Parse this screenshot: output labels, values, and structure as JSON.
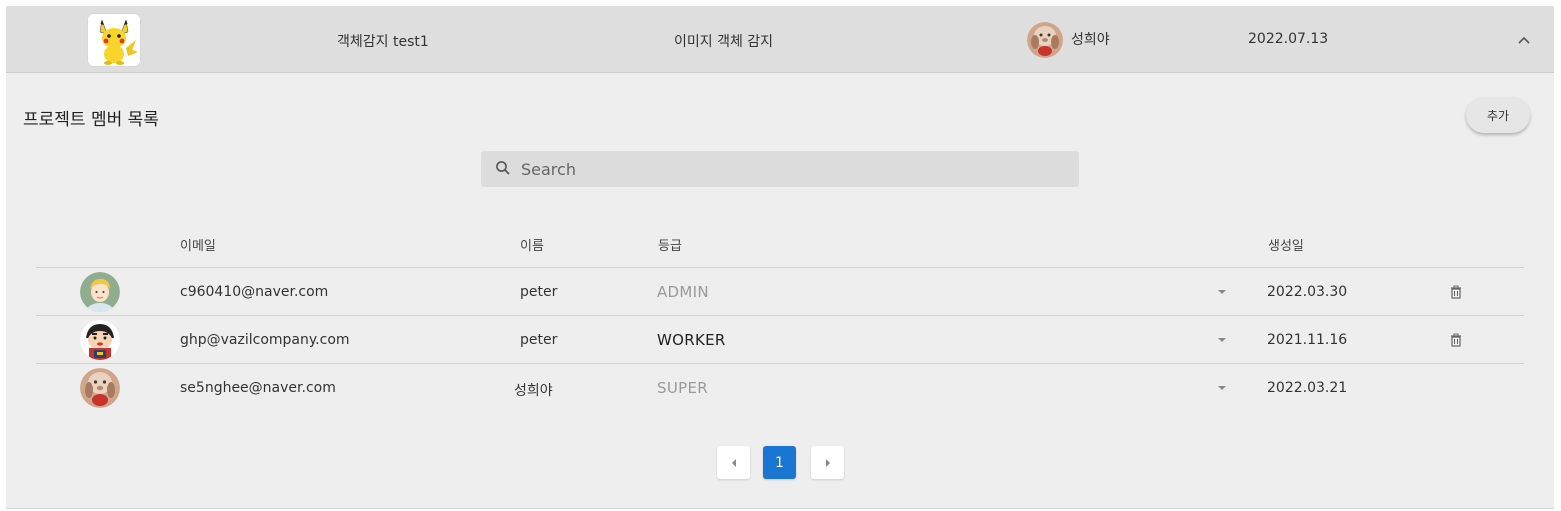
{
  "project": {
    "name": "객체감지 test1",
    "type": "이미지 객체 감지",
    "owner": "성희야",
    "date": "2022.07.13"
  },
  "members_section": {
    "title": "프로젝트 멤버 목록",
    "add_label": "추가",
    "search_placeholder": "Search",
    "columns": {
      "email": "이메일",
      "name": "이름",
      "role": "등급",
      "created": "생성일"
    },
    "rows": [
      {
        "email": "c960410@naver.com",
        "name": "peter",
        "role": "ADMIN",
        "created": "2022.03.30",
        "deletable": true,
        "role_enabled": false
      },
      {
        "email": "ghp@vazilcompany.com",
        "name": "peter",
        "role": "WORKER",
        "created": "2021.11.16",
        "deletable": true,
        "role_enabled": true
      },
      {
        "email": "se5nghee@naver.com",
        "name": "성희야",
        "role": "SUPER",
        "created": "2022.03.21",
        "deletable": false,
        "role_enabled": false
      }
    ]
  },
  "pagination": {
    "current_page": "1"
  },
  "colors": {
    "accent": "#1976d2",
    "header_bg": "#dedede",
    "panel_bg": "#eeeeee"
  },
  "icons": {
    "search": "search-icon",
    "collapse": "chevron-up-icon",
    "delete": "trash-icon",
    "role_dropdown": "caret-down-icon",
    "prev": "chevron-left-icon",
    "next": "chevron-right-icon"
  }
}
